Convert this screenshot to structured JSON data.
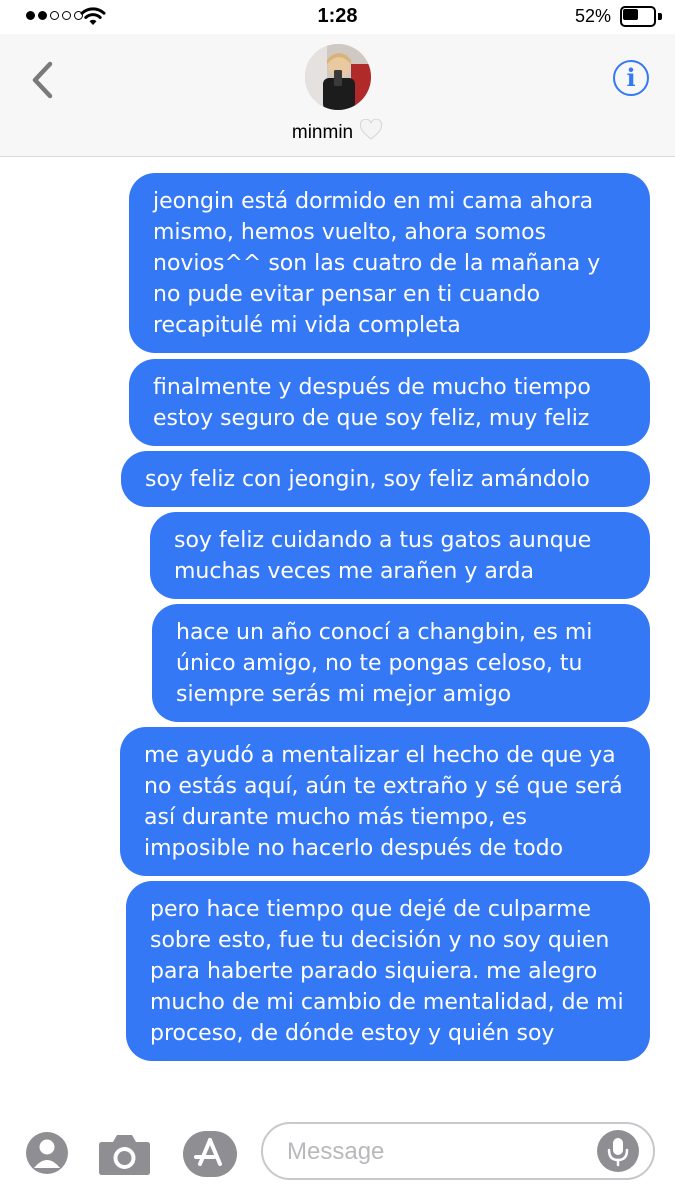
{
  "status_bar": {
    "time": "1:28",
    "battery_percent": "52%",
    "battery_level": 0.52,
    "signal_bars": 2,
    "signal_total": 5
  },
  "header": {
    "contact_name": "minmin",
    "heart_emoji": "white-heart-icon"
  },
  "messages": [
    {
      "text": "jeongin está dormido en mi cama ahora mismo, hemos vuelto, ahora somos novios^^ son las cuatro de la mañana y no pude evitar pensar en ti cuando recapitulé mi vida completa",
      "sender": "me"
    },
    {
      "text": "finalmente y después de mucho tiempo estoy seguro de que soy feliz, muy feliz",
      "sender": "me"
    },
    {
      "text": "soy feliz con jeongin, soy feliz amándolo",
      "sender": "me"
    },
    {
      "text": "soy feliz cuidando a tus gatos aunque muchas veces me arañen y arda",
      "sender": "me"
    },
    {
      "text": "hace un año conocí a changbin, es mi único amigo, no te pongas celoso, tu siempre serás mi mejor amigo",
      "sender": "me"
    },
    {
      "text": "me ayudó a mentalizar el hecho de que ya no estás aquí, aún te extraño y sé que será así durante mucho más tiempo, es imposible no hacerlo después de todo",
      "sender": "me"
    },
    {
      "text": "pero hace tiempo que dejé de culparme sobre esto, fue tu decisión y no soy quien para haberte parado siquiera. me alegro mucho de mi cambio de mentalidad, de mi proceso, de dónde estoy y quién soy",
      "sender": "me"
    }
  ],
  "composer": {
    "placeholder": "Message"
  },
  "colors": {
    "bubble_blue": "#3478f6",
    "icon_gray": "#8e8e93"
  }
}
